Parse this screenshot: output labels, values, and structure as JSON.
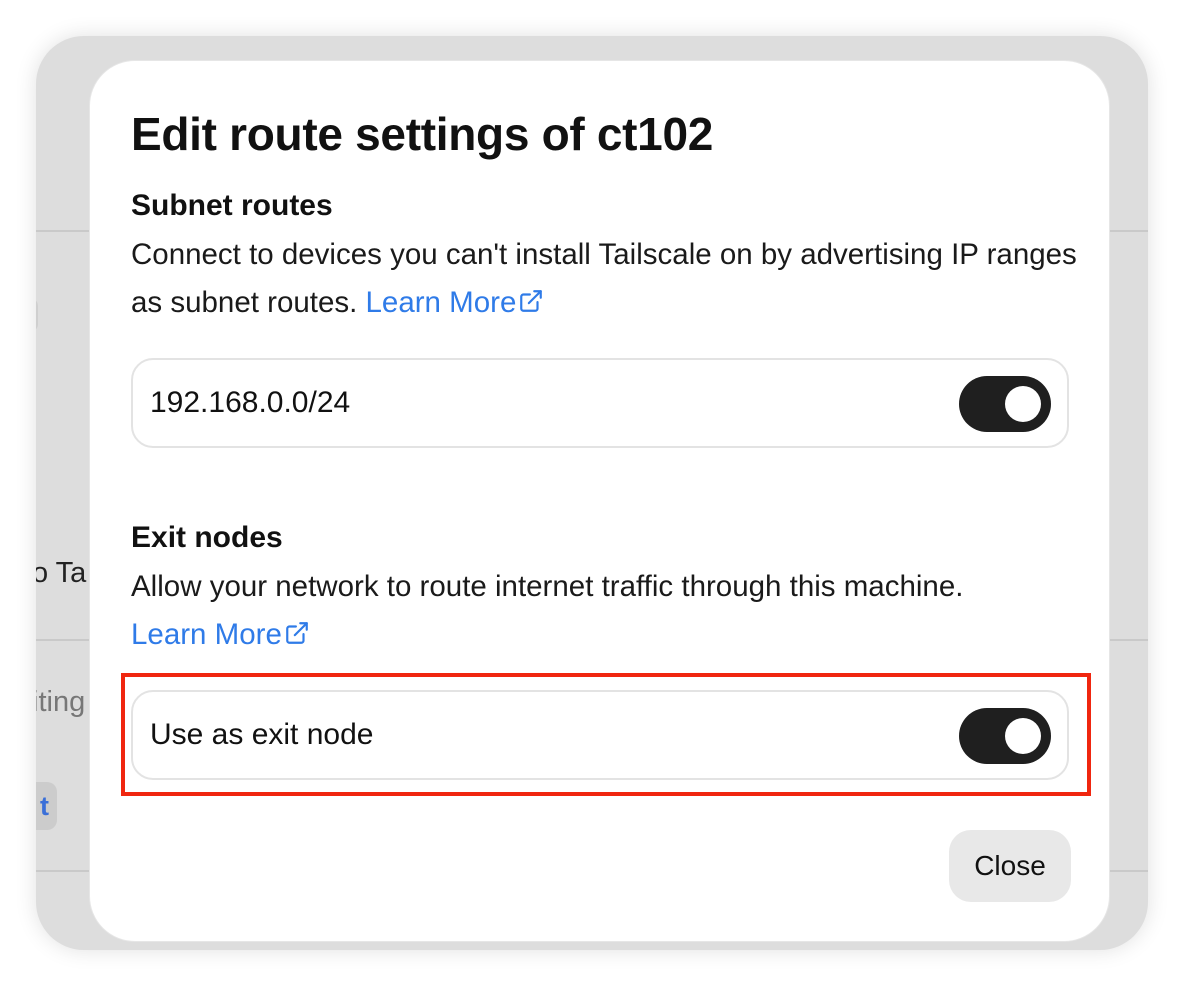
{
  "background": {
    "fragments": [
      "o Ta",
      "iting",
      "t"
    ]
  },
  "modal": {
    "title": "Edit route settings of ct102",
    "subnet": {
      "heading": "Subnet routes",
      "description": "Connect to devices you can't install Tailscale on by advertising IP ranges as subnet routes.",
      "learn_more": "Learn More",
      "route": {
        "label": "192.168.0.0/24",
        "enabled": true
      }
    },
    "exit": {
      "heading": "Exit nodes",
      "description": "Allow your network to route internet traffic through this machine.",
      "learn_more": "Learn More",
      "option": {
        "label": "Use as exit node",
        "enabled": true
      }
    },
    "close_label": "Close"
  },
  "colors": {
    "link": "#2f7be8",
    "toggle_on": "#1f1f1f",
    "highlight": "#f0260f"
  }
}
